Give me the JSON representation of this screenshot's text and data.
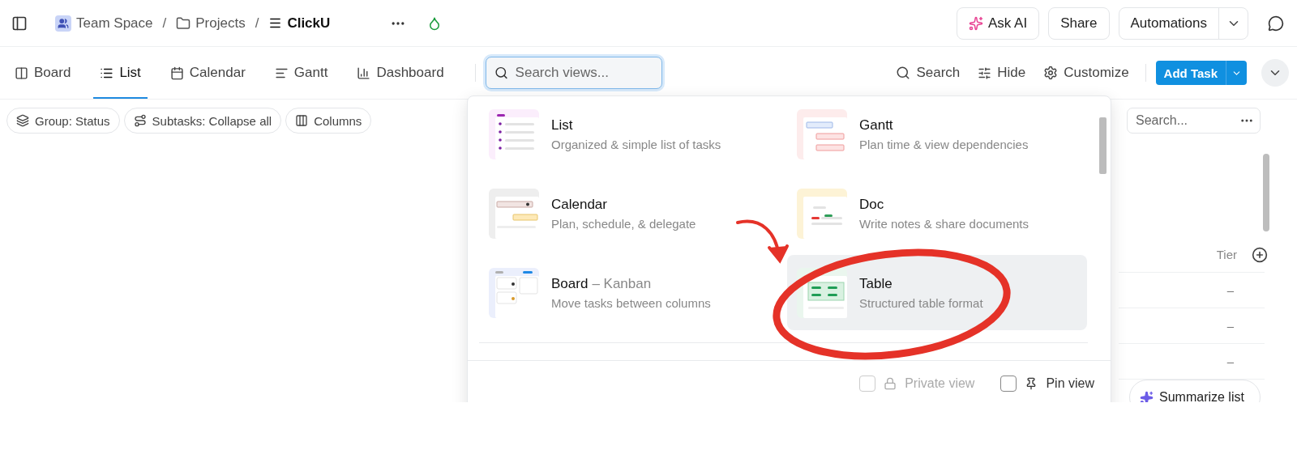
{
  "breadcrumb": [
    {
      "label": "Team Space",
      "kind": "space",
      "separator": "/"
    },
    {
      "label": "Projects",
      "kind": "folder",
      "separator": "/"
    },
    {
      "label": "ClickU",
      "kind": "list"
    }
  ],
  "header_actions": [
    {
      "label": "Ask AI",
      "kind": "ai"
    },
    {
      "label": "Share",
      "kind": "plain"
    },
    {
      "label": "Automations",
      "kind": "split"
    }
  ],
  "view_tabs": [
    {
      "label": "Board",
      "kind": "board",
      "selected": false
    },
    {
      "label": "List",
      "kind": "list",
      "selected": true
    },
    {
      "label": "Calendar",
      "kind": "calendar",
      "selected": false
    },
    {
      "label": "Gantt",
      "kind": "gantt",
      "selected": false
    },
    {
      "label": "Dashboard",
      "kind": "dashboard",
      "selected": false
    }
  ],
  "view_search": {
    "placeholder": "Search views..."
  },
  "toolbar_actions": [
    {
      "label": "Search",
      "kind": "search"
    },
    {
      "label": "Hide",
      "kind": "hide"
    },
    {
      "label": "Customize",
      "kind": "customize"
    }
  ],
  "add_task": "Add Task",
  "filters": [
    {
      "label": "Group: Status",
      "kind": "group"
    },
    {
      "label": "Subtasks: Collapse all",
      "kind": "subtasks"
    },
    {
      "label": "Columns",
      "kind": "columns"
    }
  ],
  "list_search": {
    "placeholder": "Search..."
  },
  "table": {
    "columns": [
      {
        "label": "Tier"
      }
    ],
    "rows": [
      {
        "tier": "–"
      },
      {
        "tier": "–"
      },
      {
        "tier": "–"
      }
    ]
  },
  "summarize": "Summarize list",
  "view_menu": {
    "items": [
      {
        "title": "List",
        "description": "Organized & simple list of tasks",
        "kind": "list",
        "selected": false
      },
      {
        "title": "Gantt",
        "description": "Plan time & view dependencies",
        "kind": "gantt",
        "selected": false
      },
      {
        "title": "Calendar",
        "description": "Plan, schedule, & delegate",
        "kind": "calendar",
        "selected": false
      },
      {
        "title": "Doc",
        "description": "Write notes & share documents",
        "kind": "doc",
        "selected": false
      },
      {
        "title": "Board",
        "subtitle": "– Kanban",
        "description": "Move tasks between columns",
        "kind": "board",
        "selected": false
      },
      {
        "title": "Table",
        "description": "Structured table format",
        "kind": "table",
        "selected": true
      }
    ],
    "private_view": {
      "label": "Private view",
      "checked": false,
      "disabled": true
    },
    "pin_view": {
      "label": "Pin view",
      "checked": false
    }
  }
}
